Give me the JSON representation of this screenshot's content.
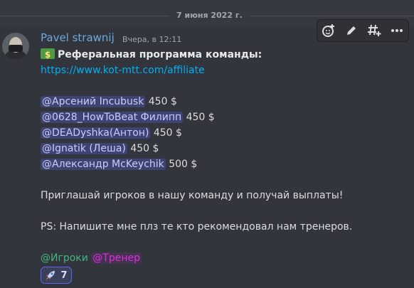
{
  "date_divider": "7 июня 2022 г.",
  "message": {
    "author": "Pavel strawnij",
    "timestamp": "Вчера, в 12:11",
    "title": "Реферальная программа команды:",
    "link": "https://www.kot-mtt.com/affiliate",
    "mentions": [
      {
        "name": "@Арсений Incubusk",
        "amount": "450 $"
      },
      {
        "name": "@0628_HowToBeat Филипп",
        "amount": "450 $"
      },
      {
        "name": "@DEADyshka(Антон)",
        "amount": "450 $"
      },
      {
        "name": "@Ignatik (Леша)",
        "amount": "450 $"
      },
      {
        "name": "@Александр McKeychik",
        "amount": "500 $"
      }
    ],
    "invite_text": "Приглашай игроков в нашу команду и получай выплаты!",
    "ps_text": "PS: Напишите мне плз те кто рекомендовал нам тренеров.",
    "roles": [
      "@Игроки",
      "@Тренер"
    ],
    "reaction": {
      "emoji": "rocket",
      "count": "7"
    }
  },
  "toolbar": [
    "add-reaction-icon",
    "edit-icon",
    "create-thread-icon",
    "more-icon"
  ],
  "colors": {
    "username": "#6fa8dc",
    "role_players": "#43b581",
    "role_coach": "#e22ae8",
    "link": "#00b0f4"
  }
}
